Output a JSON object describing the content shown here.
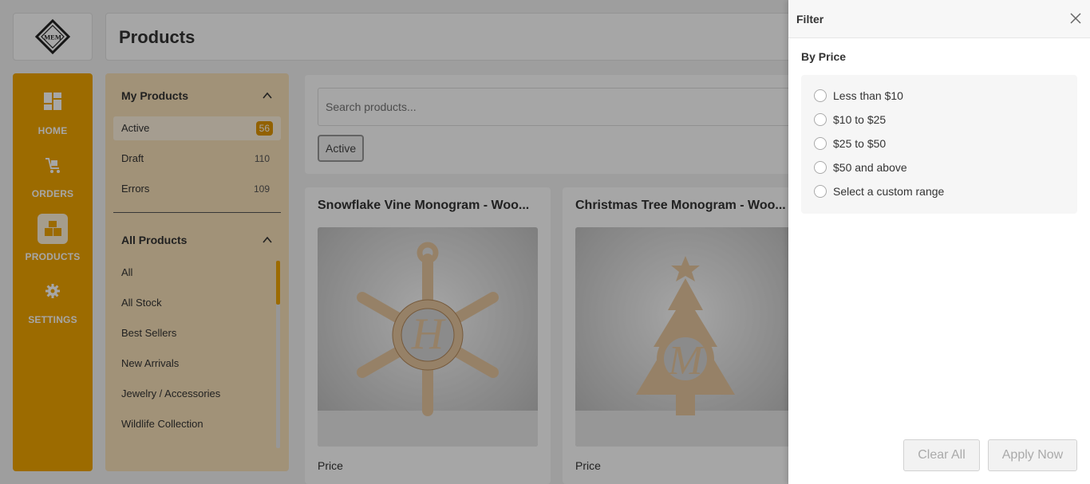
{
  "header": {
    "title": "Products"
  },
  "logo": {
    "text": "MEM"
  },
  "nav": {
    "items": [
      {
        "label": "HOME",
        "icon": "dashboard-icon"
      },
      {
        "label": "ORDERS",
        "icon": "cart-icon"
      },
      {
        "label": "PRODUCTS",
        "icon": "box-icon",
        "active": true
      },
      {
        "label": "SETTINGS",
        "icon": "gear-icon"
      }
    ]
  },
  "categories": {
    "my_products": {
      "title": "My Products",
      "items": [
        {
          "label": "Active",
          "count": "56",
          "active": true
        },
        {
          "label": "Draft",
          "count": "110"
        },
        {
          "label": "Errors",
          "count": "109"
        }
      ]
    },
    "all_products": {
      "title": "All Products",
      "items": [
        {
          "label": "All"
        },
        {
          "label": "All Stock"
        },
        {
          "label": "Best Sellers"
        },
        {
          "label": "New Arrivals"
        },
        {
          "label": "Jewelry / Accessories"
        },
        {
          "label": "Wildlife Collection"
        }
      ]
    }
  },
  "search": {
    "placeholder": "Search products...",
    "chip": "Active"
  },
  "products": [
    {
      "title": "Snowflake Vine Monogram - Woo...",
      "price_label": "Price",
      "initial": "H"
    },
    {
      "title": "Christmas Tree Monogram - Woo...",
      "price_label": "Price",
      "initial": "M"
    }
  ],
  "filter": {
    "title": "Filter",
    "section": "By Price",
    "options": [
      "Less than $10",
      "$10 to $25",
      "$25 to $50",
      "$50 and above",
      "Select a custom range"
    ],
    "clear_label": "Clear All",
    "apply_label": "Apply Now"
  },
  "colors": {
    "accent": "#f0a500",
    "badge": "#e09600",
    "panel": "#f8e0b8"
  }
}
